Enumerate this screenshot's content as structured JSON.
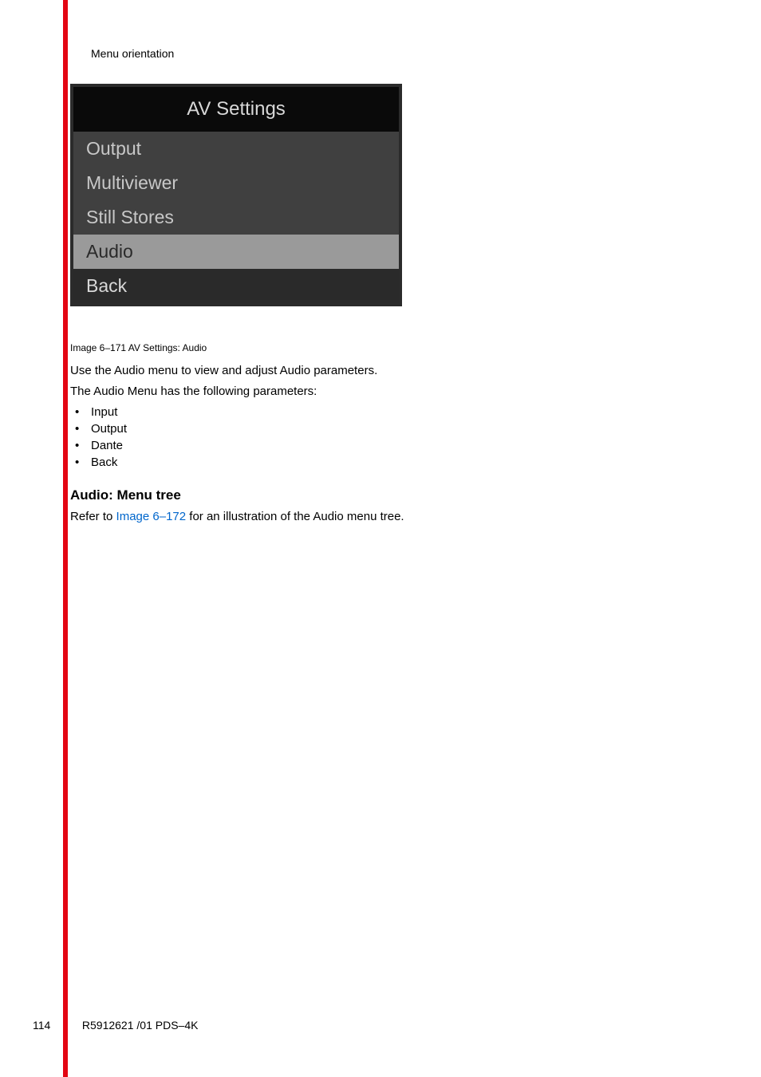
{
  "header": {
    "section_title": "Menu orientation"
  },
  "menu_screenshot": {
    "title": "AV Settings",
    "items": [
      {
        "label": "Output",
        "selected": false,
        "back": false
      },
      {
        "label": "Multiviewer",
        "selected": false,
        "back": false
      },
      {
        "label": "Still Stores",
        "selected": false,
        "back": false
      },
      {
        "label": "Audio",
        "selected": true,
        "back": false
      },
      {
        "label": "Back",
        "selected": false,
        "back": true
      }
    ]
  },
  "image_caption": "Image 6–171  AV Settings: Audio",
  "body": {
    "para1": "Use the Audio menu to view and adjust Audio parameters.",
    "para2": "The Audio Menu has the following parameters:",
    "bullets": [
      "Input",
      "Output",
      "Dante",
      "Back"
    ],
    "heading": "Audio: Menu tree",
    "para3_prefix": "Refer to ",
    "para3_link": "Image 6–172",
    "para3_suffix": " for an illustration of the Audio menu tree."
  },
  "footer": {
    "page_number": "114",
    "doc_id": "R5912621 /01 PDS–4K"
  }
}
